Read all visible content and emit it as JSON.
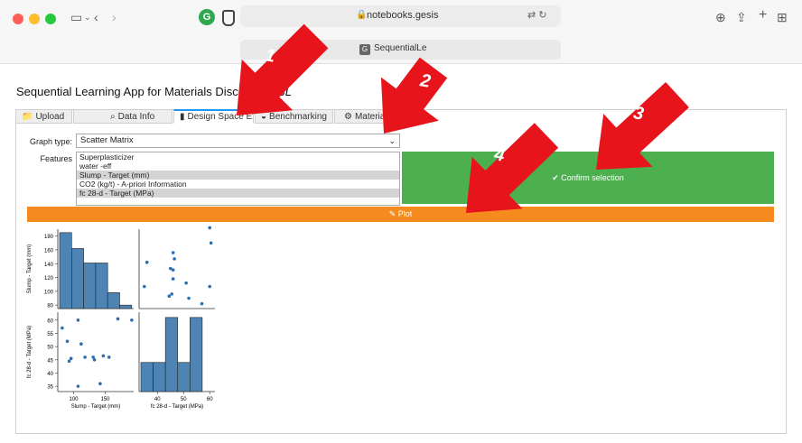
{
  "browser": {
    "url": "notebooks.gesis",
    "tab_title": "SequentialLe",
    "tab_favicon": "G",
    "extension_badge": "G"
  },
  "app": {
    "title": "Sequential Learning App for Materials Discovery - ",
    "title_italic": "SL"
  },
  "tabs": [
    {
      "label": "Upload",
      "icon": "folder-icon"
    },
    {
      "label": "Data Info",
      "icon": "search-icon"
    },
    {
      "label": "Design Space Ex",
      "icon": "chart-icon",
      "active": true
    },
    {
      "label": "Benchmarking",
      "icon": "bowl-icon"
    },
    {
      "label": "Materials D",
      "icon": "gear-icon"
    }
  ],
  "form": {
    "graph_type_label": "Graph type:",
    "graph_type_value": "Scatter Matrix",
    "features_label": "Features",
    "features": [
      {
        "label": "Superplasticizer",
        "selected": false
      },
      {
        "label": "water -eff",
        "selected": false
      },
      {
        "label": "Slump - Target (mm)",
        "selected": true
      },
      {
        "label": "CO2 (kg/t) - A-priori Information",
        "selected": false
      },
      {
        "label": "fc 28-d - Target (MPa)",
        "selected": true
      }
    ],
    "confirm_label": "✔ Confirm selection",
    "plot_label": "✎ Plot"
  },
  "chart_data": {
    "type": "scatter",
    "variables": [
      "Slump - Target (mm)",
      "fc 28-d - Target (MPa)"
    ],
    "slump_hist": {
      "bin_edges": [
        80,
        100,
        120,
        140,
        160,
        180,
        200
      ],
      "counts": [
        185,
        162,
        141,
        141,
        98,
        80
      ],
      "ylim": [
        75,
        190
      ],
      "yticks": [
        80,
        100,
        120,
        140,
        160,
        180
      ]
    },
    "fc_hist": {
      "bin_edges": [
        32,
        37.5,
        43,
        48.5,
        54,
        59.5,
        65
      ],
      "counts": [
        44,
        44,
        61,
        44,
        61,
        0
      ],
      "ylim": [
        33,
        63
      ],
      "yticks": [
        35,
        40,
        45,
        50,
        55,
        60
      ]
    },
    "scatter_fc_vs_slump": [
      [
        82,
        57
      ],
      [
        90,
        52
      ],
      [
        93,
        44.5
      ],
      [
        96,
        45.5
      ],
      [
        107,
        60
      ],
      [
        107,
        35
      ],
      [
        112,
        51
      ],
      [
        118,
        46
      ],
      [
        131,
        46
      ],
      [
        133,
        45
      ],
      [
        142,
        36
      ],
      [
        147,
        46.5
      ],
      [
        156,
        46
      ],
      [
        170,
        60.5
      ],
      [
        192,
        60
      ]
    ],
    "xlim_slump": [
      75,
      195
    ],
    "xticks_slump": [
      100,
      150
    ],
    "xlim_fc": [
      33,
      62
    ],
    "xticks_fc": [
      40,
      50,
      60
    ],
    "xlabels": [
      "Slump - Target (mm)",
      "fc 28-d - Target (MPa)"
    ],
    "ylabels": [
      "Slump - Target (mm)",
      "fc 28-d - Target (MPa)"
    ]
  },
  "annotations": [
    "1",
    "2",
    "3",
    "4"
  ],
  "colors": {
    "confirm": "#4caf50",
    "plot": "#f58a1f",
    "bar": "#4e84b3",
    "point": "#2a6fb0",
    "arrow": "#e8141c",
    "active_tab": "#2196f3"
  }
}
